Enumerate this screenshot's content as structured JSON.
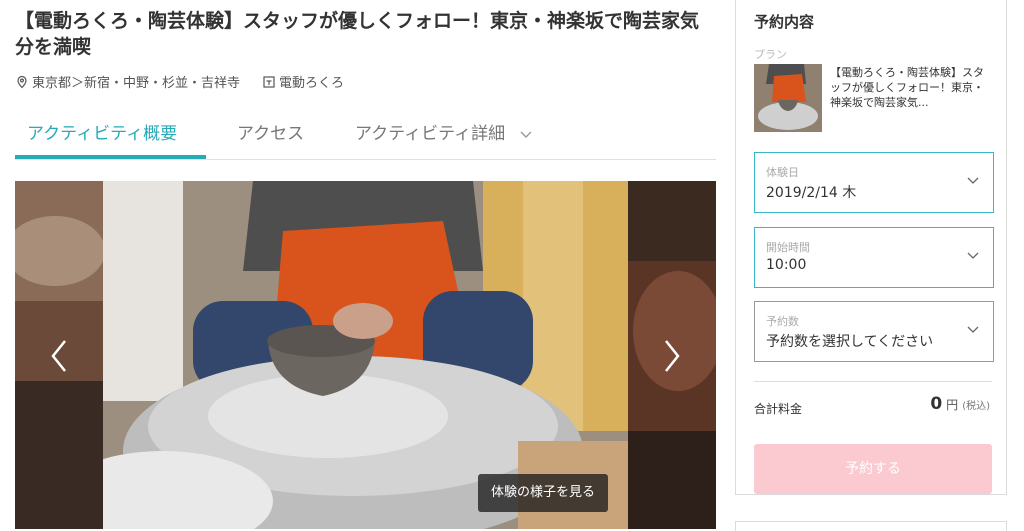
{
  "activity": {
    "title": "【電動ろくろ・陶芸体験】スタッフが優しくフォロー！東京・神楽坂で陶芸家気分を満喫",
    "location": "東京都＞新宿・中野・杉並・吉祥寺",
    "category": "電動ろくろ"
  },
  "tabs": [
    {
      "label": "アクティビティ概要",
      "active": true
    },
    {
      "label": "アクセス",
      "active": false
    },
    {
      "label": "アクティビティ詳細",
      "active": false
    }
  ],
  "gallery": {
    "video_label": "体験の様子を見る"
  },
  "booking": {
    "title": "予約内容",
    "plan_label": "プラン",
    "plan_text": "【電動ろくろ・陶芸体験】スタッフが優しくフォロー！東京・神楽坂で陶芸家気...",
    "date": {
      "label": "体験日",
      "value": "2019/2/14 木"
    },
    "time": {
      "label": "開始時間",
      "value": "10:00"
    },
    "count": {
      "label": "予約数",
      "value": "予約数を選択してください"
    },
    "total_label": "合計料金",
    "total_value": "0",
    "currency": "円",
    "tax_note": "(税込)",
    "reserve_label": "予約する"
  },
  "colors": {
    "accent": "#25aab8",
    "field_active_border": "#3ab7c4",
    "reserve_button": "#fbc9d0"
  }
}
